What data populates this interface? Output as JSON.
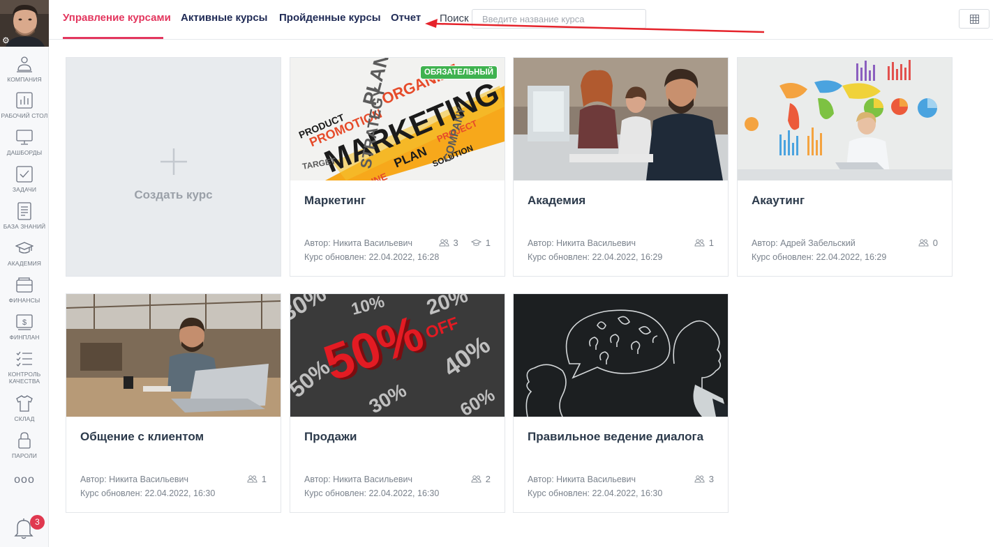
{
  "sidebar": {
    "items": [
      {
        "label": "КОМПАНИЯ",
        "icon": "company-icon"
      },
      {
        "label": "РАБОЧИЙ СТОЛ",
        "icon": "desktop-chart-icon"
      },
      {
        "label": "ДАШБОРДЫ",
        "icon": "monitor-icon"
      },
      {
        "label": "ЗАДАЧИ",
        "icon": "checkbox-icon"
      },
      {
        "label": "БАЗА ЗНАНИЙ",
        "icon": "document-icon"
      },
      {
        "label": "АКАДЕМИЯ",
        "icon": "graduation-cap-icon"
      },
      {
        "label": "ФИНАНСЫ",
        "icon": "wallet-icon"
      },
      {
        "label": "ФИНПЛАН",
        "icon": "dollar-icon"
      },
      {
        "label": "КОНТРОЛЬ КАЧЕСТВА",
        "icon": "checklist-icon"
      },
      {
        "label": "СКЛАД",
        "icon": "tshirt-icon"
      },
      {
        "label": "ПАРОЛИ",
        "icon": "lock-icon"
      }
    ],
    "more": "ooo",
    "notifications": "3"
  },
  "header": {
    "tabs": [
      {
        "label": "Управление курсами",
        "active": true
      },
      {
        "label": "Активные курсы"
      },
      {
        "label": "Пройденные курсы"
      },
      {
        "label": "Отчет"
      }
    ],
    "search_label": "Поиск",
    "search_placeholder": "Введите название курса"
  },
  "create_card": {
    "label": "Создать курс"
  },
  "courses": [
    {
      "title": "Маркетинг",
      "author": "Автор: Никита Васильевич",
      "updated": "Курс обновлен: 22.04.2022, 16:28",
      "users": "3",
      "graduates": "1",
      "badge": "ОБЯЗАТЕЛЬНЫЙ"
    },
    {
      "title": "Академия",
      "author": "Автор: Никита Васильевич",
      "updated": "Курс обновлен: 22.04.2022, 16:29",
      "users": "1"
    },
    {
      "title": "Акаутинг",
      "author": "Автор: Адрей Забельский",
      "updated": "Курс обновлен: 22.04.2022, 16:29",
      "users": "0"
    },
    {
      "title": "Общение с клиентом",
      "author": "Автор: Никита Васильевич",
      "updated": "Курс обновлен: 22.04.2022, 16:30",
      "users": "1"
    },
    {
      "title": "Продажи",
      "author": "Автор: Никита Васильевич",
      "updated": "Курс обновлен: 22.04.2022, 16:30",
      "users": "2"
    },
    {
      "title": "Правильное ведение диалога",
      "author": "Автор: Никита Васильевич",
      "updated": "Курс обновлен: 22.04.2022, 16:30",
      "users": "3"
    }
  ],
  "colors": {
    "accent": "#e3365e",
    "nav_text": "#1f2a55",
    "badge_green": "#3fb24f",
    "notification": "#e0384f"
  }
}
